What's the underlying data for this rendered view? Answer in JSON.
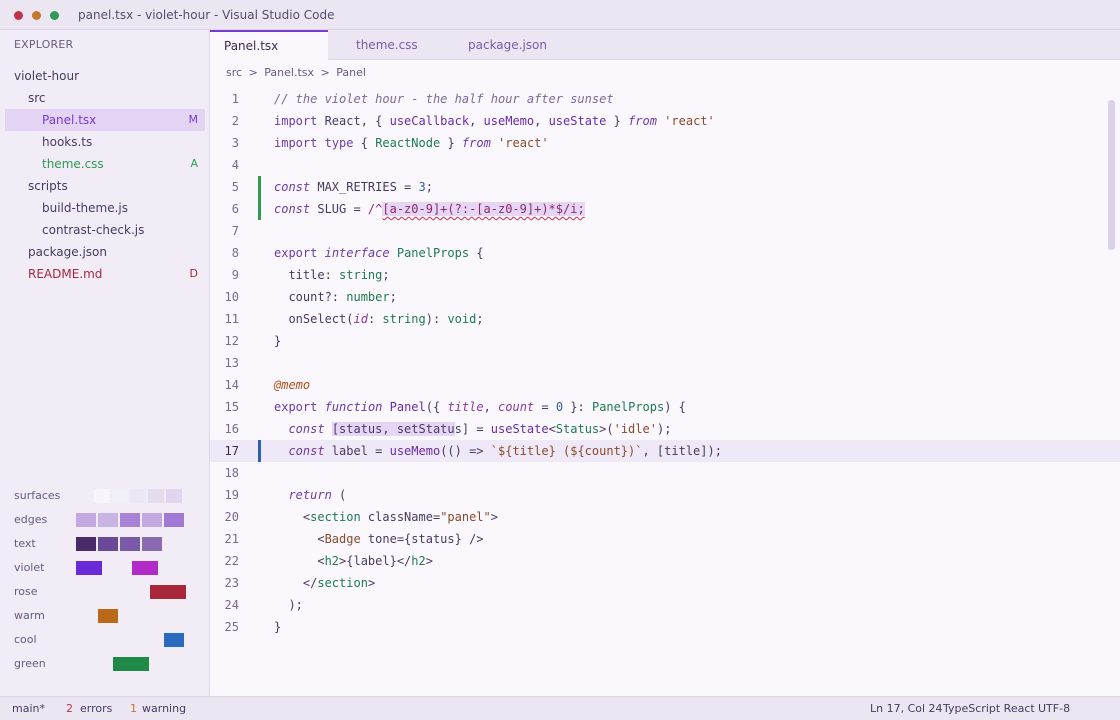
{
  "window": {
    "title": "panel.tsx - violet-hour - Visual Studio Code"
  },
  "sidebar": {
    "title": "EXPLORER",
    "tree": [
      {
        "label": "violet-hour",
        "indent": 0,
        "color": "#4a3a62",
        "badge": "",
        "badge_color": ""
      },
      {
        "label": "src",
        "indent": 1,
        "color": "#4a3a62",
        "badge": "",
        "badge_color": ""
      },
      {
        "label": "Panel.tsx",
        "indent": 2,
        "color": "#7a3ad0",
        "badge": "M",
        "badge_color": "#7a3ad0",
        "selected": true
      },
      {
        "label": "hooks.ts",
        "indent": 2,
        "color": "#4a3a62",
        "badge": "",
        "badge_color": ""
      },
      {
        "label": "theme.css",
        "indent": 2,
        "color": "#2f9a52",
        "badge": "A",
        "badge_color": "#2f9a52"
      },
      {
        "label": "scripts",
        "indent": 1,
        "color": "#4a3a62",
        "badge": "",
        "badge_color": ""
      },
      {
        "label": "build-theme.js",
        "indent": 2,
        "color": "#4a3a62",
        "badge": "",
        "badge_color": ""
      },
      {
        "label": "contrast-check.js",
        "indent": 2,
        "color": "#4a3a62",
        "badge": "",
        "badge_color": ""
      },
      {
        "label": "package.json",
        "indent": 1,
        "color": "#4a3a62",
        "badge": "",
        "badge_color": ""
      },
      {
        "label": "README.md",
        "indent": 1,
        "color": "#a8283a",
        "badge": "D",
        "badge_color": "#a8283a"
      }
    ],
    "palette": [
      {
        "label": "surfaces",
        "colors": [
          "#f8f6fb",
          "#f3eff8",
          "#ede6f4",
          "#e6dcf0",
          "#e0d4ee"
        ]
      },
      {
        "label": "edges",
        "colors": [
          "#c4a8e2",
          "#c8b4e0",
          "#a884d6",
          "#c4a8e2",
          "#a07ad6"
        ]
      },
      {
        "label": "text",
        "colors": [
          "#4a2a68",
          "#6a4a98",
          "#7a5aa8",
          "#8a6ab0"
        ]
      },
      {
        "label": "violet",
        "colors": [
          "#6a2ad8",
          "#b02ac8"
        ]
      },
      {
        "label": "rose",
        "colors": [
          "#a8283a"
        ]
      },
      {
        "label": "warm",
        "colors": [
          "#b86a1a"
        ]
      },
      {
        "label": "cool",
        "colors": [
          "#2a6ac0"
        ]
      },
      {
        "label": "green",
        "colors": [
          "#1f8a48"
        ]
      }
    ]
  },
  "tabs": [
    {
      "label": "Panel.tsx",
      "active": true
    },
    {
      "label": "theme.css",
      "active": false
    },
    {
      "label": "package.json",
      "active": false
    }
  ],
  "breadcrumb": [
    "src",
    ">",
    "Panel.tsx",
    ">",
    "Panel"
  ],
  "editor": {
    "current_line": 17,
    "lines": [
      {
        "n": "1",
        "tokens": [
          [
            "// the violet hour - the half hour after sunset",
            "comment"
          ]
        ]
      },
      {
        "n": "2",
        "tokens": [
          [
            "import",
            "kw"
          ],
          [
            " React, { ",
            ""
          ],
          [
            "useCallback",
            "fn"
          ],
          [
            ", ",
            ""
          ],
          [
            "useMemo",
            "fn"
          ],
          [
            ", ",
            ""
          ],
          [
            "useState",
            "fn"
          ],
          [
            " } ",
            ""
          ],
          [
            "from",
            "kwi"
          ],
          [
            " ",
            ""
          ],
          [
            "'react'",
            "str"
          ]
        ]
      },
      {
        "n": "3",
        "tokens": [
          [
            "import",
            "kw"
          ],
          [
            " ",
            ""
          ],
          [
            "type",
            "kw"
          ],
          [
            " { ",
            ""
          ],
          [
            "ReactNode",
            "type"
          ],
          [
            " } ",
            ""
          ],
          [
            "from",
            "kwi"
          ],
          [
            " ",
            ""
          ],
          [
            "'react'",
            "str"
          ]
        ]
      },
      {
        "n": "4",
        "tokens": []
      },
      {
        "n": "5",
        "mark": "add",
        "tokens": [
          [
            "const",
            "kwi"
          ],
          [
            " MAX_RETRIES = ",
            ""
          ],
          [
            "3",
            "num"
          ],
          [
            ";",
            ""
          ]
        ]
      },
      {
        "n": "6",
        "mark": "add",
        "tokens": [
          [
            "const",
            "kwi"
          ],
          [
            " SLUG = ",
            ""
          ],
          [
            "/^",
            "regex"
          ],
          [
            "[a-z0-9]+(?:-[a-z0-9]+)*$/i;",
            "regex-hl"
          ]
        ]
      },
      {
        "n": "7",
        "tokens": []
      },
      {
        "n": "8",
        "tokens": [
          [
            "export",
            "kw"
          ],
          [
            " ",
            ""
          ],
          [
            "interface",
            "kwi"
          ],
          [
            " ",
            ""
          ],
          [
            "PanelProps",
            "type"
          ],
          [
            " {",
            ""
          ]
        ]
      },
      {
        "n": "9",
        "tokens": [
          [
            "  title: ",
            ""
          ],
          [
            "string",
            "type"
          ],
          [
            ";",
            ""
          ]
        ]
      },
      {
        "n": "10",
        "tokens": [
          [
            "  count?: ",
            ""
          ],
          [
            "number",
            "type"
          ],
          [
            ";",
            ""
          ]
        ]
      },
      {
        "n": "11",
        "tokens": [
          [
            "  onSelect(",
            ""
          ],
          [
            "id",
            "var"
          ],
          [
            ": ",
            ""
          ],
          [
            "string",
            "type"
          ],
          [
            "): ",
            ""
          ],
          [
            "void",
            "type"
          ],
          [
            ";",
            ""
          ]
        ]
      },
      {
        "n": "12",
        "tokens": [
          [
            "}",
            ""
          ]
        ]
      },
      {
        "n": "13",
        "tokens": []
      },
      {
        "n": "14",
        "tokens": [
          [
            "@memo",
            "deco"
          ]
        ]
      },
      {
        "n": "15",
        "tokens": [
          [
            "export",
            "kw"
          ],
          [
            " ",
            ""
          ],
          [
            "function",
            "kwi"
          ],
          [
            " ",
            ""
          ],
          [
            "Panel",
            "fn"
          ],
          [
            "({ ",
            ""
          ],
          [
            "title",
            "var"
          ],
          [
            ", ",
            ""
          ],
          [
            "count",
            "var"
          ],
          [
            " = ",
            ""
          ],
          [
            "0",
            "num"
          ],
          [
            " }: ",
            ""
          ],
          [
            "PanelProps",
            "type"
          ],
          [
            ") {",
            ""
          ]
        ]
      },
      {
        "n": "16",
        "tokens": [
          [
            "  ",
            ""
          ],
          [
            "const",
            "kwi"
          ],
          [
            " ",
            ""
          ],
          [
            "[status, setStatu",
            "hl"
          ],
          [
            "s] = ",
            ""
          ],
          [
            "useState",
            "fn"
          ],
          [
            "<",
            ""
          ],
          [
            "Status",
            "type"
          ],
          [
            ">(",
            ""
          ],
          [
            "'idle'",
            "str"
          ],
          [
            ");",
            ""
          ]
        ]
      },
      {
        "n": "17",
        "mark": "mod",
        "tokens": [
          [
            "  ",
            ""
          ],
          [
            "const",
            "kwi"
          ],
          [
            " label = ",
            ""
          ],
          [
            "useMemo",
            "fn"
          ],
          [
            "(() => ",
            ""
          ],
          [
            "`${title} (${count})`",
            "str"
          ],
          [
            ", [title]);",
            ""
          ]
        ]
      },
      {
        "n": "18",
        "tokens": []
      },
      {
        "n": "19",
        "tokens": [
          [
            "  ",
            ""
          ],
          [
            "return",
            "kwi"
          ],
          [
            " (",
            ""
          ]
        ]
      },
      {
        "n": "20",
        "tokens": [
          [
            "    <",
            ""
          ],
          [
            "section",
            "tag"
          ],
          [
            " className=",
            ""
          ],
          [
            "\"panel\"",
            "str"
          ],
          [
            ">",
            ""
          ]
        ]
      },
      {
        "n": "21",
        "tokens": [
          [
            "      <",
            ""
          ],
          [
            "Badge",
            "deco-plain"
          ],
          [
            " tone={status} />",
            ""
          ]
        ]
      },
      {
        "n": "22",
        "tokens": [
          [
            "      <",
            ""
          ],
          [
            "h2",
            "tag"
          ],
          [
            ">{label}</",
            ""
          ],
          [
            "h2",
            "tag"
          ],
          [
            ">",
            ""
          ]
        ]
      },
      {
        "n": "23",
        "tokens": [
          [
            "    </",
            ""
          ],
          [
            "section",
            "tag"
          ],
          [
            ">",
            ""
          ]
        ]
      },
      {
        "n": "24",
        "tokens": [
          [
            "  );",
            ""
          ]
        ]
      },
      {
        "n": "25",
        "tokens": [
          [
            "}",
            ""
          ]
        ]
      }
    ]
  },
  "statusbar": {
    "branch": "main*",
    "errors_count": "2",
    "errors_label": "errors",
    "warnings_count": "1",
    "warnings_label": "warning",
    "position": "Ln 17, Col 24",
    "language": "TypeScript React",
    "encoding": "UTF-8"
  }
}
